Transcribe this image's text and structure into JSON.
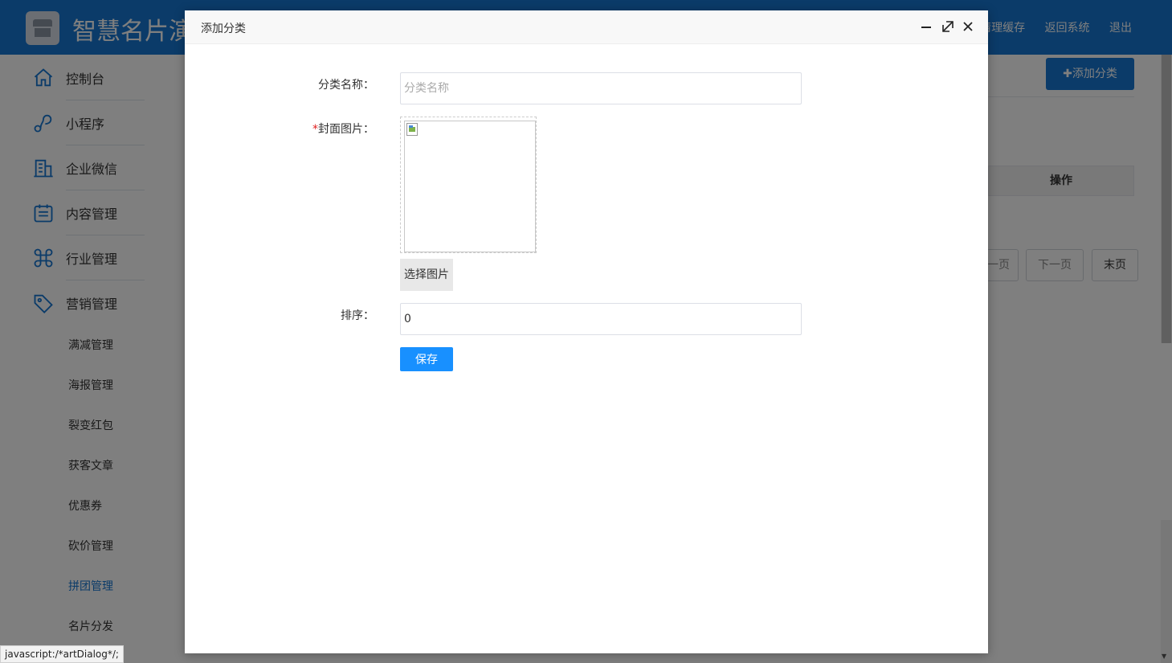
{
  "header": {
    "title": "智慧名片演",
    "links": [
      "清理缓存",
      "返回系统",
      "退出"
    ]
  },
  "sidebar": {
    "items": [
      {
        "label": "控制台",
        "icon": "home-icon"
      },
      {
        "label": "小程序",
        "icon": "link-icon"
      },
      {
        "label": "企业微信",
        "icon": "building-icon"
      },
      {
        "label": "内容管理",
        "icon": "calendar-icon"
      },
      {
        "label": "行业管理",
        "icon": "command-icon"
      },
      {
        "label": "营销管理",
        "icon": "tag-icon"
      }
    ],
    "subitems": [
      "满减管理",
      "海报管理",
      "裂变红包",
      "获客文章",
      "优惠券",
      "砍价管理",
      "拼团管理",
      "名片分发"
    ],
    "active_subitem": "拼团管理"
  },
  "main": {
    "add_button": "添加分类",
    "table_header_operation": "操作",
    "pager": {
      "prev_partial": "一页",
      "next": "下一页",
      "last": "末页"
    }
  },
  "dialog": {
    "title": "添加分类",
    "fields": {
      "name_label": "分类名称：",
      "name_placeholder": "分类名称",
      "name_value": "",
      "cover_required_mark": "*",
      "cover_label": "封面图片：",
      "select_image_button": "选择图片",
      "sort_label": "排序：",
      "sort_value": "0"
    },
    "save_button": "保存"
  },
  "status_bar": "javascript:/*artDialog*/;",
  "colors": {
    "primary": "#1677d2",
    "save": "#1890ff",
    "required": "#e02020"
  }
}
